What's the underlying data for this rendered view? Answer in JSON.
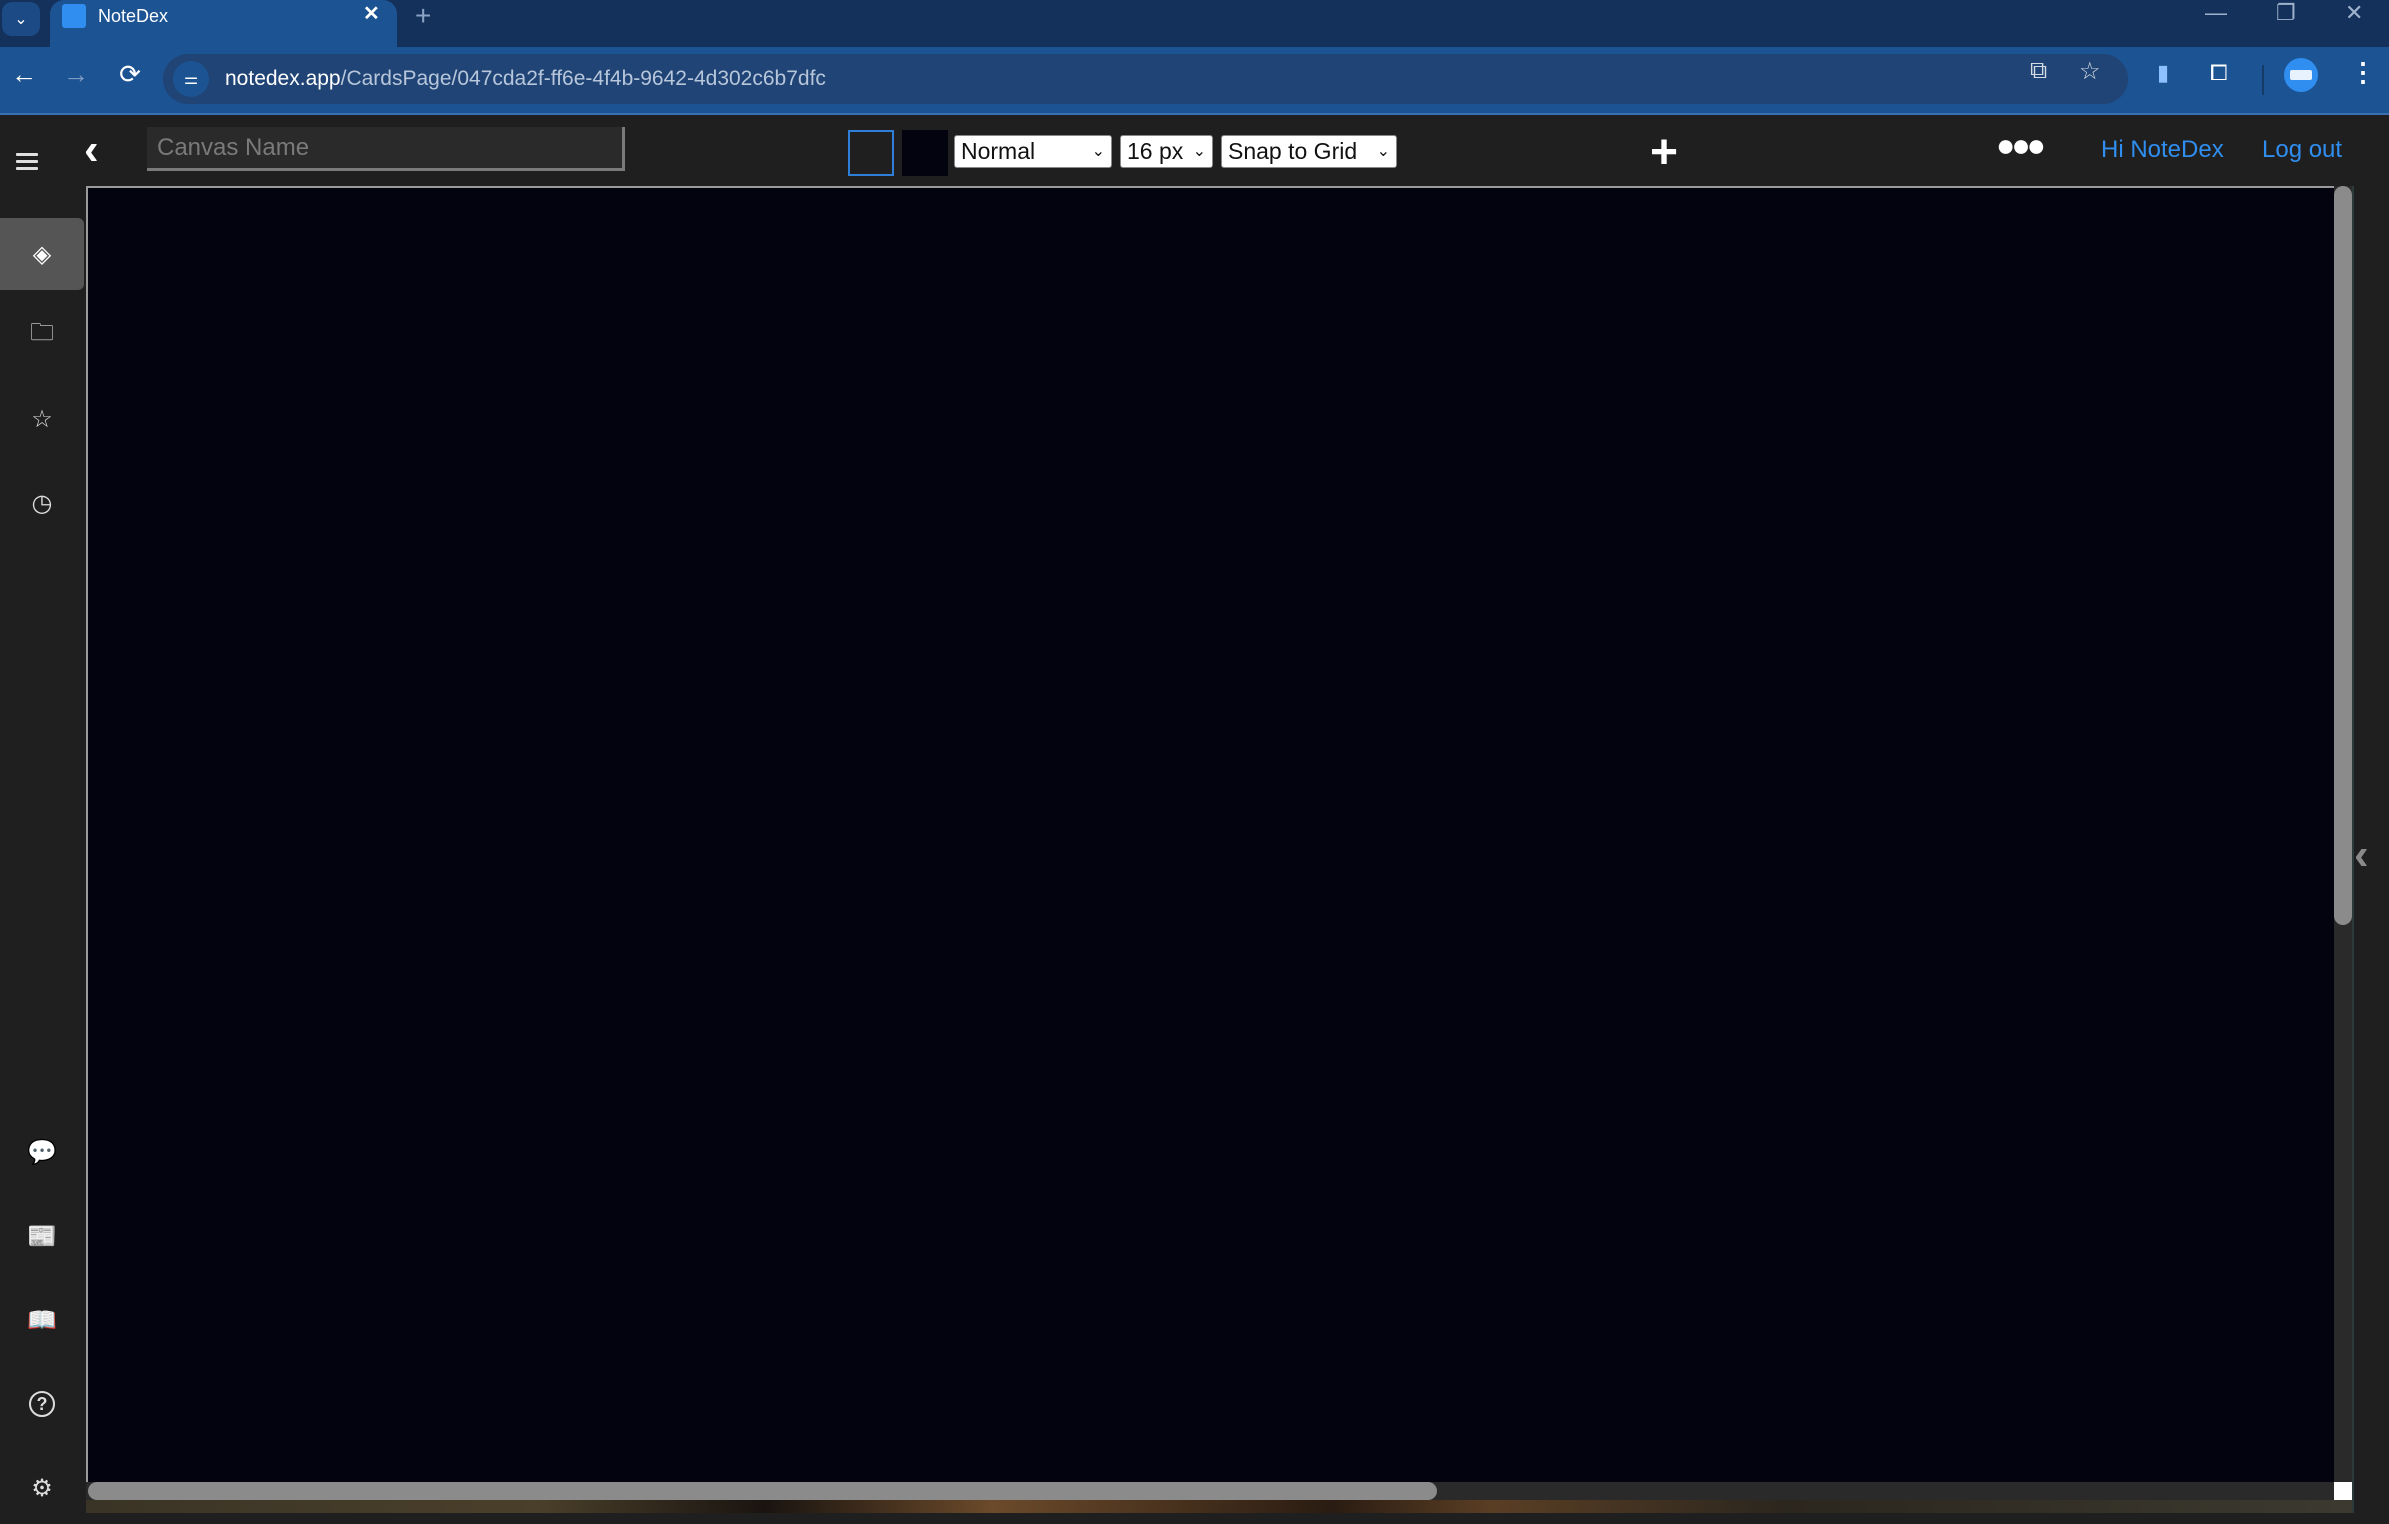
{
  "browser": {
    "tab": {
      "title": "NoteDex",
      "favicon": "notedex-stack-icon",
      "close": "✕"
    },
    "new_tab": "+",
    "window_controls": {
      "minimize": "—",
      "restore": "❐",
      "close": "✕"
    },
    "nav": {
      "back": "←",
      "forward": "→",
      "reload": "⟳"
    },
    "url": {
      "host": "notedex.app",
      "path": "/CardsPage/047cda2f-ff6e-4f4b-9642-4d302c6b7dfc"
    },
    "omnibox_icons": {
      "site_info": "⚌",
      "open_in_app": "⧉",
      "bookmark": "☆"
    },
    "extension_icons": {
      "side_panel": "▮",
      "extensions": "⧠"
    },
    "menu": "⋮"
  },
  "header": {
    "back_glyph": "‹",
    "canvas_name": {
      "value": "",
      "placeholder": "Canvas Name"
    },
    "colors": {
      "border_color": "#2f7fd8",
      "fill_color": "#03020f"
    },
    "font_weight_select": {
      "selected": "Normal"
    },
    "font_size_select": {
      "selected": "16 px"
    },
    "snap_select": {
      "selected": "Snap to Grid"
    },
    "chevron": "⌄",
    "add_glyph": "+",
    "more_glyph": "●●●",
    "greeting": "Hi NoteDex",
    "logout": "Log out"
  },
  "sidebar": {
    "top_items": [
      {
        "name": "canvases",
        "glyph": "◈",
        "active": true
      },
      {
        "name": "folders",
        "glyph": "🗀",
        "active": false
      },
      {
        "name": "favorites",
        "glyph": "☆",
        "active": false
      },
      {
        "name": "recent",
        "glyph": "◷",
        "active": false
      }
    ],
    "bottom_items": [
      {
        "name": "feedback",
        "glyph": "💬"
      },
      {
        "name": "news",
        "glyph": "📰"
      },
      {
        "name": "guide",
        "glyph": "📖"
      },
      {
        "name": "help",
        "glyph": "?"
      },
      {
        "name": "settings",
        "glyph": "⚙"
      }
    ]
  },
  "canvas": {
    "background": "#03020f",
    "scroll": {
      "horizontal_fraction_visible": 0.6,
      "vertical_fraction_visible": 0.57
    }
  },
  "right_panel": {
    "toggle_glyph": "‹"
  },
  "colors": {
    "accent": "#2f8ef0",
    "chrome_bg": "#1c5392",
    "app_bg": "#1f1f1f"
  }
}
